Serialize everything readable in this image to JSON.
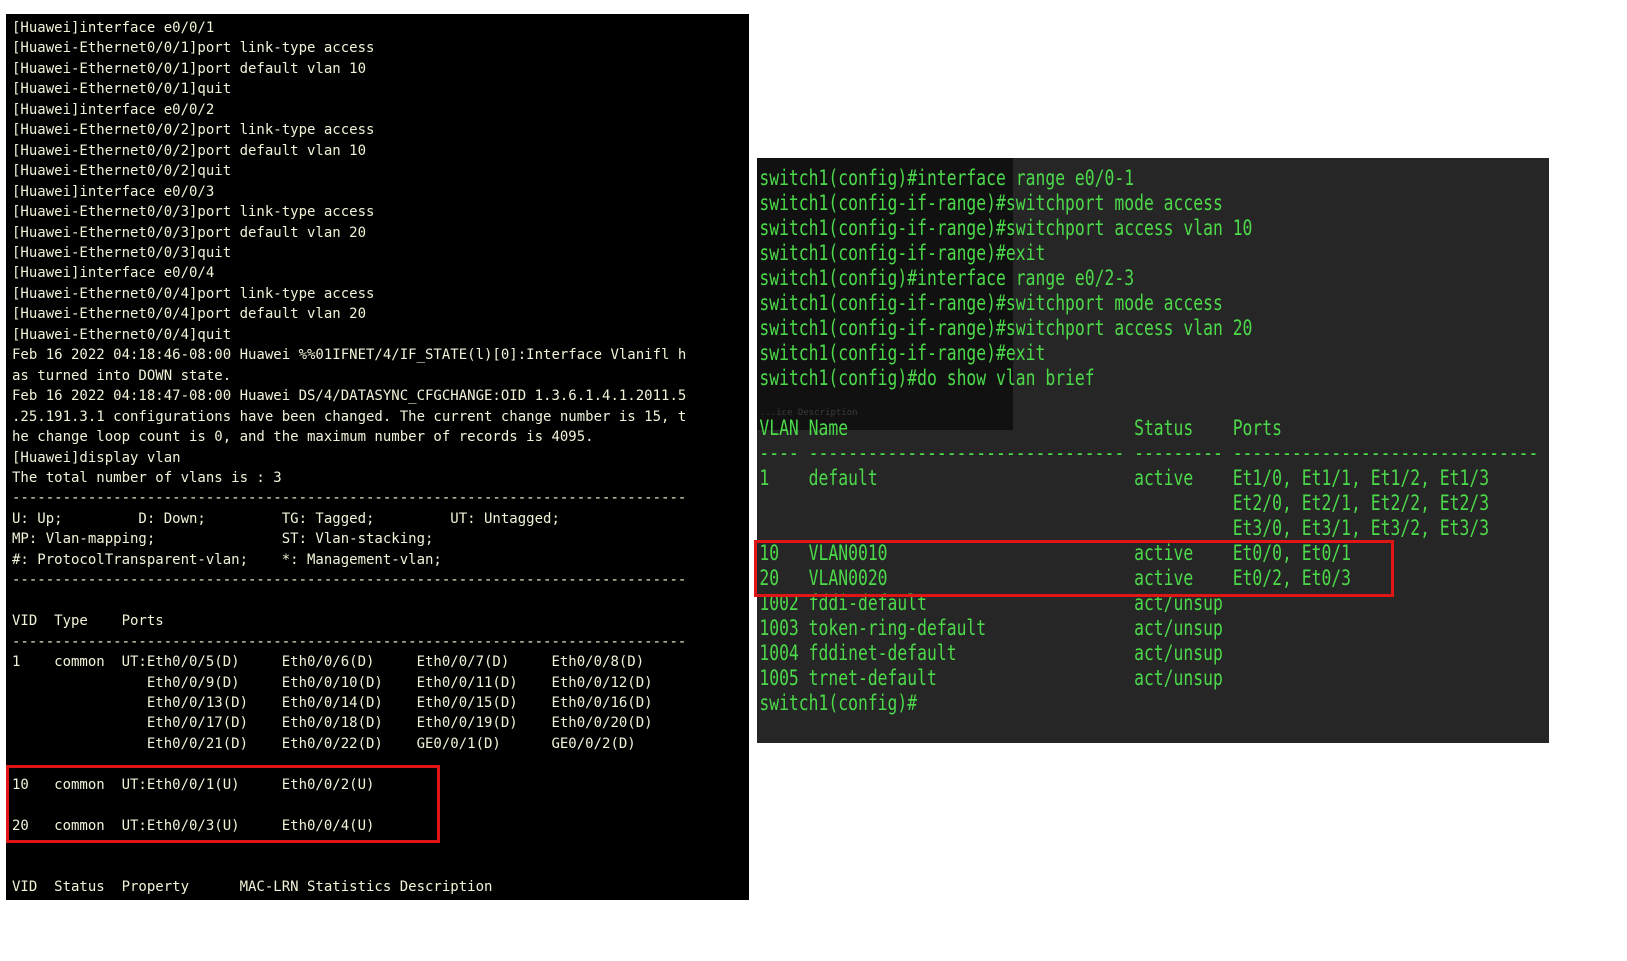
{
  "huawei_terminal": {
    "lines": [
      "[Huawei]interface e0/0/1",
      "[Huawei-Ethernet0/0/1]port link-type access",
      "[Huawei-Ethernet0/0/1]port default vlan 10",
      "[Huawei-Ethernet0/0/1]quit",
      "[Huawei]interface e0/0/2",
      "[Huawei-Ethernet0/0/2]port link-type access",
      "[Huawei-Ethernet0/0/2]port default vlan 10",
      "[Huawei-Ethernet0/0/2]quit",
      "[Huawei]interface e0/0/3",
      "[Huawei-Ethernet0/0/3]port link-type access",
      "[Huawei-Ethernet0/0/3]port default vlan 20",
      "[Huawei-Ethernet0/0/3]quit",
      "[Huawei]interface e0/0/4",
      "[Huawei-Ethernet0/0/4]port link-type access",
      "[Huawei-Ethernet0/0/4]port default vlan 20",
      "[Huawei-Ethernet0/0/4]quit",
      "Feb 16 2022 04:18:46-08:00 Huawei %%01IFNET/4/IF_STATE(l)[0]:Interface Vlanifl h",
      "as turned into DOWN state.",
      "Feb 16 2022 04:18:47-08:00 Huawei DS/4/DATASYNC_CFGCHANGE:OID 1.3.6.1.4.1.2011.5",
      ".25.191.3.1 configurations have been changed. The current change number is 15, t",
      "he change loop count is 0, and the maximum number of records is 4095.",
      "[Huawei]display vlan",
      "The total number of vlans is : 3",
      "--------------------------------------------------------------------------------",
      "U: Up;         D: Down;         TG: Tagged;         UT: Untagged;",
      "MP: Vlan-mapping;               ST: Vlan-stacking;",
      "#: ProtocolTransparent-vlan;    *: Management-vlan;",
      "--------------------------------------------------------------------------------",
      "",
      "VID  Type    Ports",
      "--------------------------------------------------------------------------------",
      "1    common  UT:Eth0/0/5(D)     Eth0/0/6(D)     Eth0/0/7(D)     Eth0/0/8(D)",
      "                Eth0/0/9(D)     Eth0/0/10(D)    Eth0/0/11(D)    Eth0/0/12(D)",
      "                Eth0/0/13(D)    Eth0/0/14(D)    Eth0/0/15(D)    Eth0/0/16(D)",
      "                Eth0/0/17(D)    Eth0/0/18(D)    Eth0/0/19(D)    Eth0/0/20(D)",
      "                Eth0/0/21(D)    Eth0/0/22(D)    GE0/0/1(D)      GE0/0/2(D)",
      "",
      "10   common  UT:Eth0/0/1(U)     Eth0/0/2(U)",
      "",
      "20   common  UT:Eth0/0/3(U)     Eth0/0/4(U)",
      "",
      "",
      "VID  Status  Property      MAC-LRN Statistics Description"
    ]
  },
  "cisco_terminal": {
    "faint_text": "...ice Description",
    "lines": [
      "switch1(config)#interface range e0/0-1",
      "switch1(config-if-range)#switchport mode access",
      "switch1(config-if-range)#switchport access vlan 10",
      "switch1(config-if-range)#exit",
      "switch1(config)#interface range e0/2-3",
      "switch1(config-if-range)#switchport mode access",
      "switch1(config-if-range)#switchport access vlan 20",
      "switch1(config-if-range)#exit",
      "switch1(config)#do show vlan brief",
      "",
      "VLAN Name                             Status    Ports",
      "---- -------------------------------- --------- -------------------------------",
      "1    default                          active    Et1/0, Et1/1, Et1/2, Et1/3",
      "                                                Et2/0, Et2/1, Et2/2, Et2/3",
      "                                                Et3/0, Et3/1, Et3/2, Et3/3",
      "10   VLAN0010                         active    Et0/0, Et0/1",
      "20   VLAN0020                         active    Et0/2, Et0/3",
      "1002 fddi-default                     act/unsup",
      "1003 token-ring-default               act/unsup",
      "1004 fddinet-default                  act/unsup",
      "1005 trnet-default                    act/unsup",
      "switch1(config)#"
    ]
  },
  "colors": {
    "huawei_bg": "#000000",
    "huawei_text": "#f2f2d8",
    "cisco_bg": "#262626",
    "cisco_text": "#4cd94a",
    "highlight": "#e01515"
  }
}
